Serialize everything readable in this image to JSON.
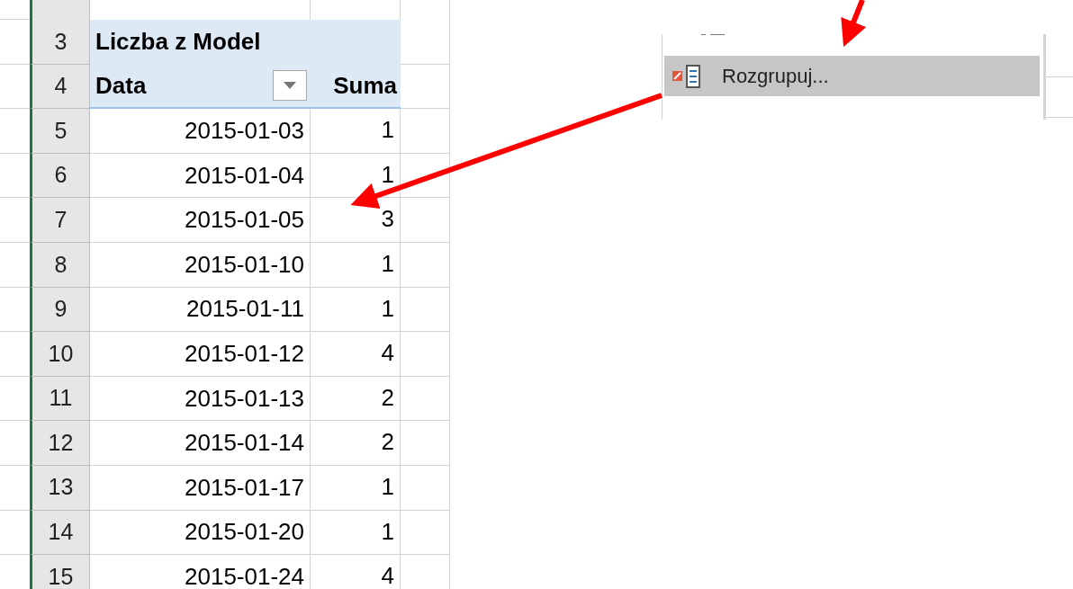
{
  "sheet": {
    "row_numbers": [
      "3",
      "4",
      "5",
      "6",
      "7",
      "8",
      "9",
      "10",
      "11",
      "12",
      "13",
      "14",
      "15"
    ],
    "pivot": {
      "title": "Liczba z Model",
      "columns": [
        {
          "label": "Data",
          "filter_button": true
        },
        {
          "label": "Suma",
          "filter_button": false
        }
      ],
      "rows": [
        [
          "2015-01-03",
          "1"
        ],
        [
          "2015-01-04",
          "1"
        ],
        [
          "2015-01-05",
          "3"
        ],
        [
          "2015-01-10",
          "1"
        ],
        [
          "2015-01-11",
          "1"
        ],
        [
          "2015-01-12",
          "4"
        ],
        [
          "2015-01-13",
          "2"
        ],
        [
          "2015-01-14",
          "2"
        ],
        [
          "2015-01-17",
          "1"
        ],
        [
          "2015-01-20",
          "1"
        ],
        [
          "2015-01-24",
          "4"
        ]
      ]
    }
  },
  "context_menu": {
    "items": [
      {
        "label": "Rozgrupuj...",
        "selected": true
      }
    ]
  }
}
